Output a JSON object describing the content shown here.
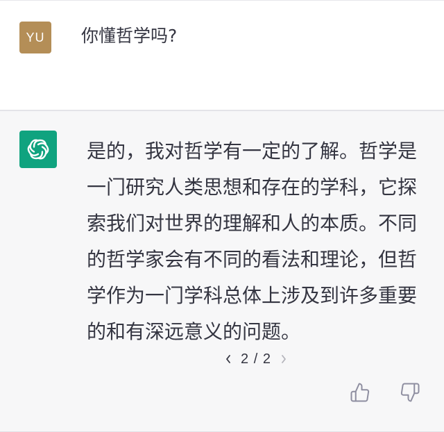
{
  "user": {
    "avatar_initials": "YU",
    "avatar_color": "#b48e57",
    "message": "你懂哲学吗?"
  },
  "assistant": {
    "avatar_icon": "openai-logo-icon",
    "avatar_color": "#10a37f",
    "message": "是的，我对哲学有一定的了解。哲学是一门研究人类思想和存在的学科，它探索我们对世界的理解和人的本质。不同的哲学家会有不同的看法和理论，但哲学作为一门学科总体上涉及到许多重要的和有深远意义的问题。",
    "pager": {
      "label": "2 / 2",
      "prev_icon": "chevron-left-icon",
      "next_icon": "chevron-right-icon"
    },
    "feedback": {
      "up_icon": "thumbs-up-icon",
      "down_icon": "thumbs-down-icon"
    }
  }
}
